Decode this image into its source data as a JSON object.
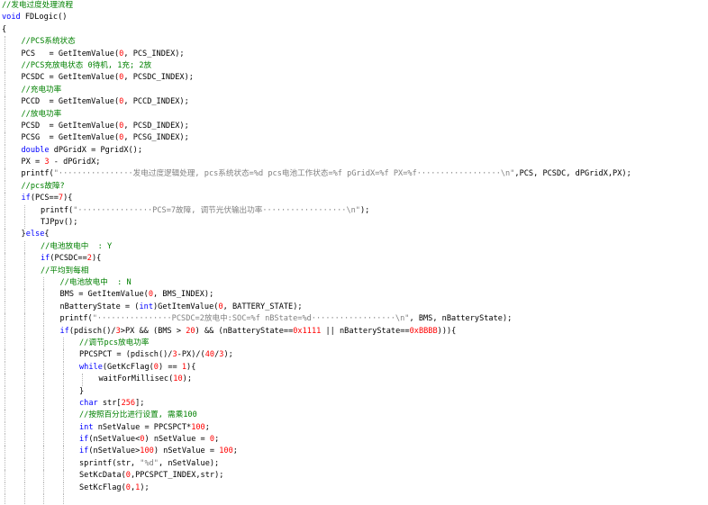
{
  "theme": {
    "comment": "#008000",
    "keyword": "#0000ff",
    "number": "#ff0000",
    "string": "#808080",
    "plain": "#000000"
  },
  "code": {
    "lines": [
      {
        "indent": 0,
        "tokens": [
          [
            "c",
            "//发电过度处理流程"
          ]
        ]
      },
      {
        "indent": 0,
        "tokens": [
          [
            "k",
            "void"
          ],
          [
            "p",
            " FDLogic()"
          ]
        ]
      },
      {
        "indent": 0,
        "tokens": [
          [
            "p",
            "{"
          ]
        ]
      },
      {
        "indent": 1,
        "tokens": [
          [
            "c",
            "//PCS系统状态"
          ]
        ]
      },
      {
        "indent": 1,
        "tokens": [
          [
            "p",
            "PCS   = GetItemValue("
          ],
          [
            "n",
            "0"
          ],
          [
            "p",
            ", PCS_INDEX);"
          ]
        ]
      },
      {
        "indent": 1,
        "tokens": [
          [
            "c",
            "//PCS充放电状态 0待机, 1充; 2放"
          ]
        ]
      },
      {
        "indent": 1,
        "tokens": [
          [
            "p",
            "PCSDC = GetItemValue("
          ],
          [
            "n",
            "0"
          ],
          [
            "p",
            ", PCSDC_INDEX);"
          ]
        ]
      },
      {
        "indent": 1,
        "tokens": [
          [
            "c",
            "//充电功率"
          ]
        ]
      },
      {
        "indent": 1,
        "tokens": [
          [
            "p",
            "PCCD  = GetItemValue("
          ],
          [
            "n",
            "0"
          ],
          [
            "p",
            ", PCCD_INDEX);"
          ]
        ]
      },
      {
        "indent": 1,
        "tokens": [
          [
            "c",
            "//放电功率"
          ]
        ]
      },
      {
        "indent": 1,
        "tokens": [
          [
            "p",
            "PCSD  = GetItemValue("
          ],
          [
            "n",
            "0"
          ],
          [
            "p",
            ", PCSD_INDEX);"
          ]
        ]
      },
      {
        "indent": 1,
        "tokens": [
          [
            "p",
            "PCSG  = GetItemValue("
          ],
          [
            "n",
            "0"
          ],
          [
            "p",
            ", PCSG_INDEX);"
          ]
        ]
      },
      {
        "indent": 1,
        "tokens": [
          [
            "k",
            "double"
          ],
          [
            "p",
            " dPGridX = PgridX();"
          ]
        ]
      },
      {
        "indent": 1,
        "tokens": [
          [
            "p",
            "PX = "
          ],
          [
            "n",
            "3"
          ],
          [
            "p",
            " - dPGridX;"
          ]
        ]
      },
      {
        "indent": 1,
        "tokens": [
          [
            "p",
            "printf("
          ],
          [
            "s",
            "\"················发电过度逻辑处理, pcs系统状态=%d pcs电池工作状态=%f pGridX=%f PX=%f··················\\n\""
          ],
          [
            "p",
            ",PCS, PCSDC, dPGridX,PX);"
          ]
        ]
      },
      {
        "indent": 1,
        "tokens": [
          [
            "c",
            "//pcs故障?"
          ]
        ]
      },
      {
        "indent": 1,
        "tokens": [
          [
            "k",
            "if"
          ],
          [
            "p",
            "(PCS=="
          ],
          [
            "n",
            "7"
          ],
          [
            "p",
            "){"
          ]
        ]
      },
      {
        "indent": 2,
        "tokens": [
          [
            "p",
            "printf("
          ],
          [
            "s",
            "\"················PCS=7故障, 调节光伏输出功率··················\\n\""
          ],
          [
            "p",
            ");"
          ]
        ]
      },
      {
        "indent": 2,
        "tokens": [
          [
            "p",
            "TJPpv();"
          ]
        ]
      },
      {
        "indent": 1,
        "tokens": [
          [
            "p",
            "}"
          ],
          [
            "k",
            "else"
          ],
          [
            "p",
            "{"
          ]
        ]
      },
      {
        "indent": 2,
        "tokens": [
          [
            "c",
            "//电池放电中  : Y"
          ]
        ]
      },
      {
        "indent": 2,
        "tokens": [
          [
            "k",
            "if"
          ],
          [
            "p",
            "(PCSDC=="
          ],
          [
            "n",
            "2"
          ],
          [
            "p",
            "){"
          ]
        ]
      },
      {
        "indent": 2,
        "tokens": [
          [
            "c",
            "//平均到每相"
          ]
        ]
      },
      {
        "indent": 3,
        "tokens": [
          [
            "c",
            "//电池放电中  : N"
          ]
        ]
      },
      {
        "indent": 3,
        "tokens": [
          [
            "p",
            "BMS = GetItemValue("
          ],
          [
            "n",
            "0"
          ],
          [
            "p",
            ", BMS_INDEX);"
          ]
        ]
      },
      {
        "indent": 3,
        "tokens": [
          [
            "p",
            "nBatteryState = ("
          ],
          [
            "k",
            "int"
          ],
          [
            "p",
            ")GetItemValue("
          ],
          [
            "n",
            "0"
          ],
          [
            "p",
            ", BATTERY_STATE);"
          ]
        ]
      },
      {
        "indent": 3,
        "tokens": [
          [
            "p",
            "printf("
          ],
          [
            "s",
            "\"················PCSDC=2放电中:SOC=%f nBState=%d··················\\n\""
          ],
          [
            "p",
            ", BMS, nBatteryState);"
          ]
        ]
      },
      {
        "indent": 3,
        "tokens": [
          [
            "k",
            "if"
          ],
          [
            "p",
            "(pdisch()/"
          ],
          [
            "n",
            "3"
          ],
          [
            "p",
            ">PX && (BMS > "
          ],
          [
            "n",
            "20"
          ],
          [
            "p",
            ") && (nBatteryState=="
          ],
          [
            "n",
            "0x1111"
          ],
          [
            "p",
            " || nBatteryState=="
          ],
          [
            "n",
            "0xBBBB"
          ],
          [
            "p",
            "))){"
          ]
        ]
      },
      {
        "indent": 4,
        "tokens": [
          [
            "c",
            "//调节pcs放电功率"
          ]
        ]
      },
      {
        "indent": 4,
        "tokens": [
          [
            "p",
            "PPCSPCT = (pdisch()/"
          ],
          [
            "n",
            "3"
          ],
          [
            "p",
            "-PX)/("
          ],
          [
            "n",
            "40"
          ],
          [
            "p",
            "/"
          ],
          [
            "n",
            "3"
          ],
          [
            "p",
            ");"
          ]
        ]
      },
      {
        "indent": 4,
        "tokens": [
          [
            "k",
            "while"
          ],
          [
            "p",
            "(GetKcFlag("
          ],
          [
            "n",
            "0"
          ],
          [
            "p",
            ") == "
          ],
          [
            "n",
            "1"
          ],
          [
            "p",
            "){"
          ]
        ]
      },
      {
        "indent": 5,
        "tokens": [
          [
            "p",
            "waitForMillisec("
          ],
          [
            "n",
            "10"
          ],
          [
            "p",
            ");"
          ]
        ]
      },
      {
        "indent": 4,
        "tokens": [
          [
            "p",
            "}"
          ]
        ]
      },
      {
        "indent": 4,
        "tokens": [
          [
            "k",
            "char"
          ],
          [
            "p",
            " str["
          ],
          [
            "n",
            "256"
          ],
          [
            "p",
            "];"
          ]
        ]
      },
      {
        "indent": 4,
        "tokens": [
          [
            "c",
            "//按照百分比进行设置, 需乘100"
          ]
        ]
      },
      {
        "indent": 4,
        "tokens": [
          [
            "k",
            "int"
          ],
          [
            "p",
            " nSetValue = PPCSPCT*"
          ],
          [
            "n",
            "100"
          ],
          [
            "p",
            ";"
          ]
        ]
      },
      {
        "indent": 4,
        "tokens": [
          [
            "k",
            "if"
          ],
          [
            "p",
            "(nSetValue<"
          ],
          [
            "n",
            "0"
          ],
          [
            "p",
            ") nSetValue = "
          ],
          [
            "n",
            "0"
          ],
          [
            "p",
            ";"
          ]
        ]
      },
      {
        "indent": 4,
        "tokens": [
          [
            "k",
            "if"
          ],
          [
            "p",
            "(nSetValue>"
          ],
          [
            "n",
            "100"
          ],
          [
            "p",
            ") nSetValue = "
          ],
          [
            "n",
            "100"
          ],
          [
            "p",
            ";"
          ]
        ]
      },
      {
        "indent": 4,
        "tokens": [
          [
            "p",
            "sprintf(str, "
          ],
          [
            "s",
            "\"%d\""
          ],
          [
            "p",
            ", nSetValue);"
          ]
        ]
      },
      {
        "indent": 4,
        "tokens": [
          [
            "p",
            "SetKcData("
          ],
          [
            "n",
            "0"
          ],
          [
            "p",
            ",PPCSPCT_INDEX,str);"
          ]
        ]
      },
      {
        "indent": 4,
        "tokens": [
          [
            "p",
            "SetKcFlag("
          ],
          [
            "n",
            "0"
          ],
          [
            "p",
            ","
          ],
          [
            "n",
            "1"
          ],
          [
            "p",
            ");"
          ]
        ]
      },
      {
        "indent": 4,
        "tokens": [
          [
            "p",
            ""
          ]
        ]
      }
    ]
  }
}
